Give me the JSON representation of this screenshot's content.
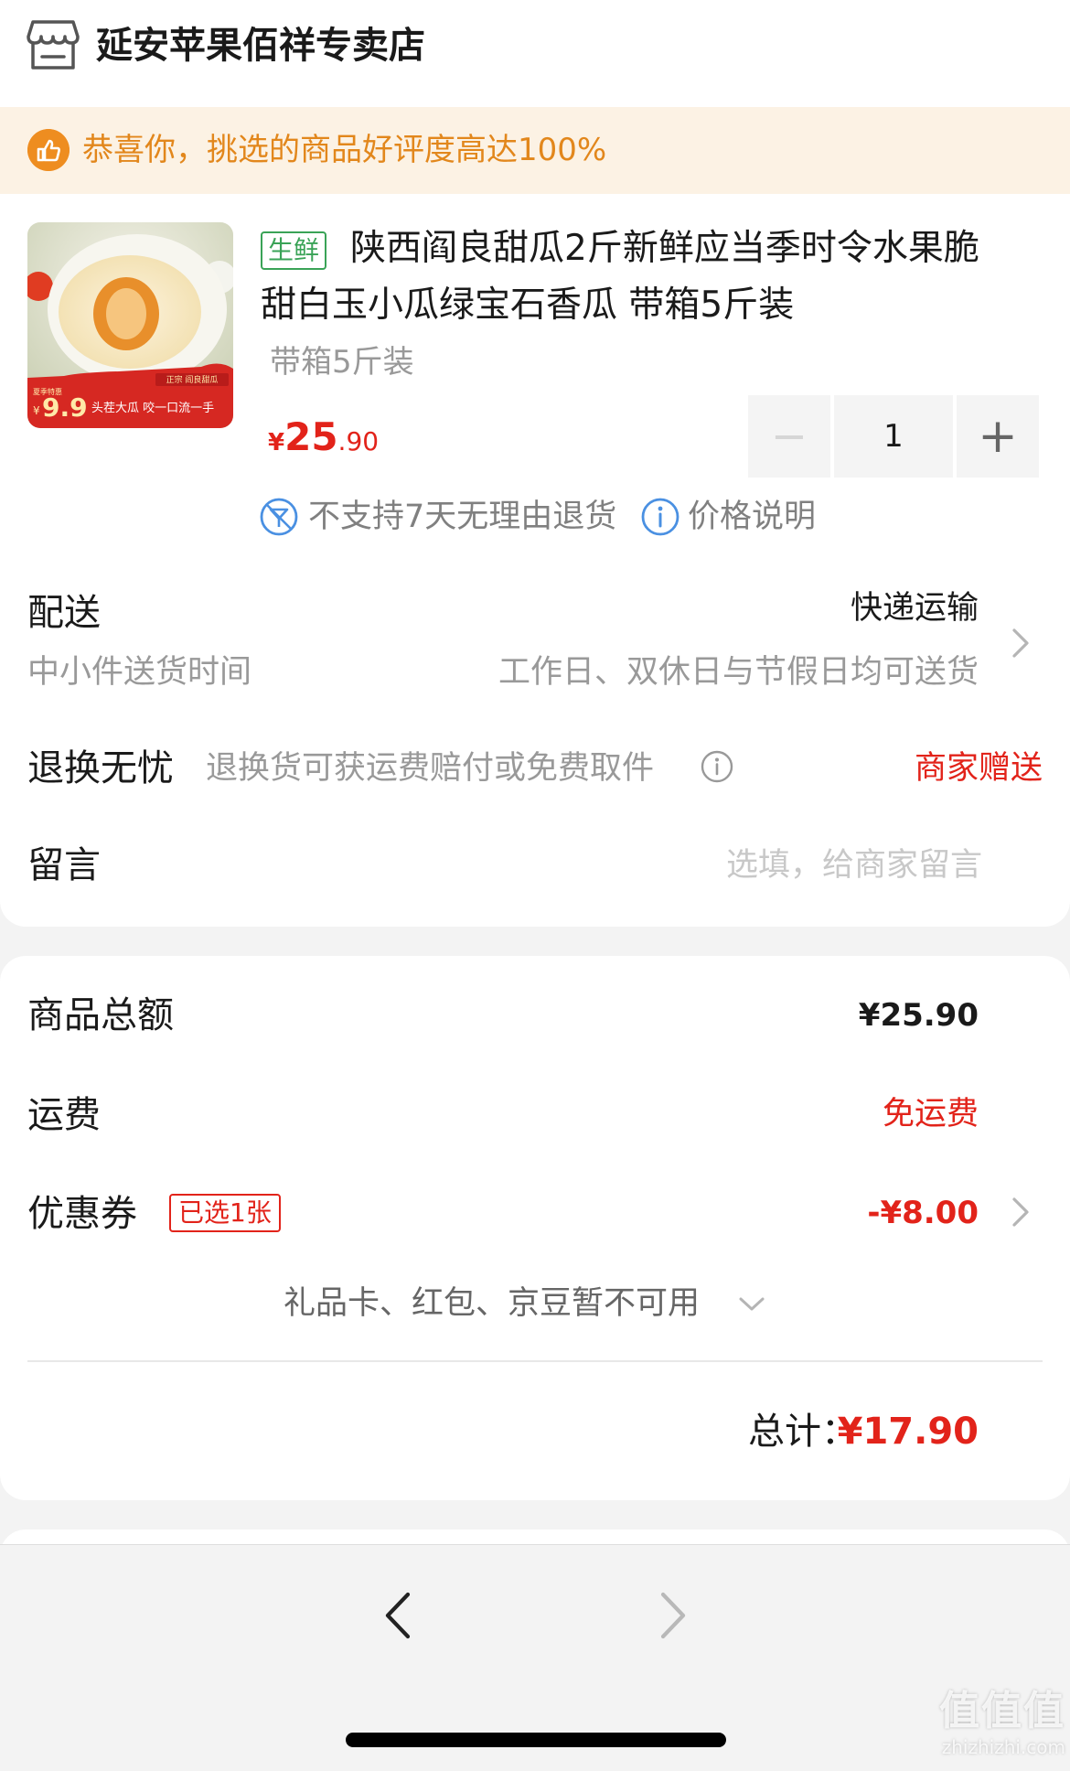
{
  "store": {
    "name": "延安苹果佰祥专卖店",
    "icon": "store-icon"
  },
  "banner": {
    "text": "恭喜你，挑选的商品好评度高达100%",
    "icon": "thumbs-up-icon"
  },
  "product": {
    "tag": "生鲜",
    "title_line1": "陕西阎良甜瓜2斤新鲜应当季时令水果脆",
    "title_line2": "甜白玉小瓜绿宝石香瓜 带箱5斤装",
    "spec": "带箱5斤装",
    "price_symbol": "¥",
    "price_int": "25",
    "price_dec": ".90",
    "quantity": "1",
    "minus": "−",
    "plus": "+",
    "image": {
      "top_label": "正宗 阎良甜瓜",
      "price_label": "9.9",
      "price_label_prefix": "¥",
      "price_label_small": "夏季特惠",
      "slogan": "头茬大瓜 咬一口流一手"
    },
    "no_return_text": "不支持7天无理由退货",
    "price_note": "价格说明"
  },
  "delivery": {
    "label": "配送",
    "method": "快递运输",
    "sub_label": "中小件送货时间",
    "time": "工作日、双休日与节假日均可送货"
  },
  "returns": {
    "label": "退换无忧",
    "desc": "退换货可获运费赔付或免费取件",
    "gift": "商家赠送"
  },
  "message": {
    "label": "留言",
    "placeholder": "选填，给商家留言"
  },
  "summary": {
    "goods_label": "商品总额",
    "goods_value": "¥25.90",
    "shipping_label": "运费",
    "shipping_value": "免运费",
    "coupon_label": "优惠券",
    "coupon_badge": "已选1张",
    "coupon_value": "-¥8.00",
    "gift_note": "礼品卡、红包、京豆暂不可用",
    "total_label": "总计：",
    "total_value": "¥17.90"
  },
  "watermark": {
    "logo": "值值值",
    "url": "zhizhizhi.com"
  },
  "colors": {
    "accent_red": "#e2231a",
    "banner_orange": "#e2871c",
    "fresh_green": "#3aa357"
  }
}
